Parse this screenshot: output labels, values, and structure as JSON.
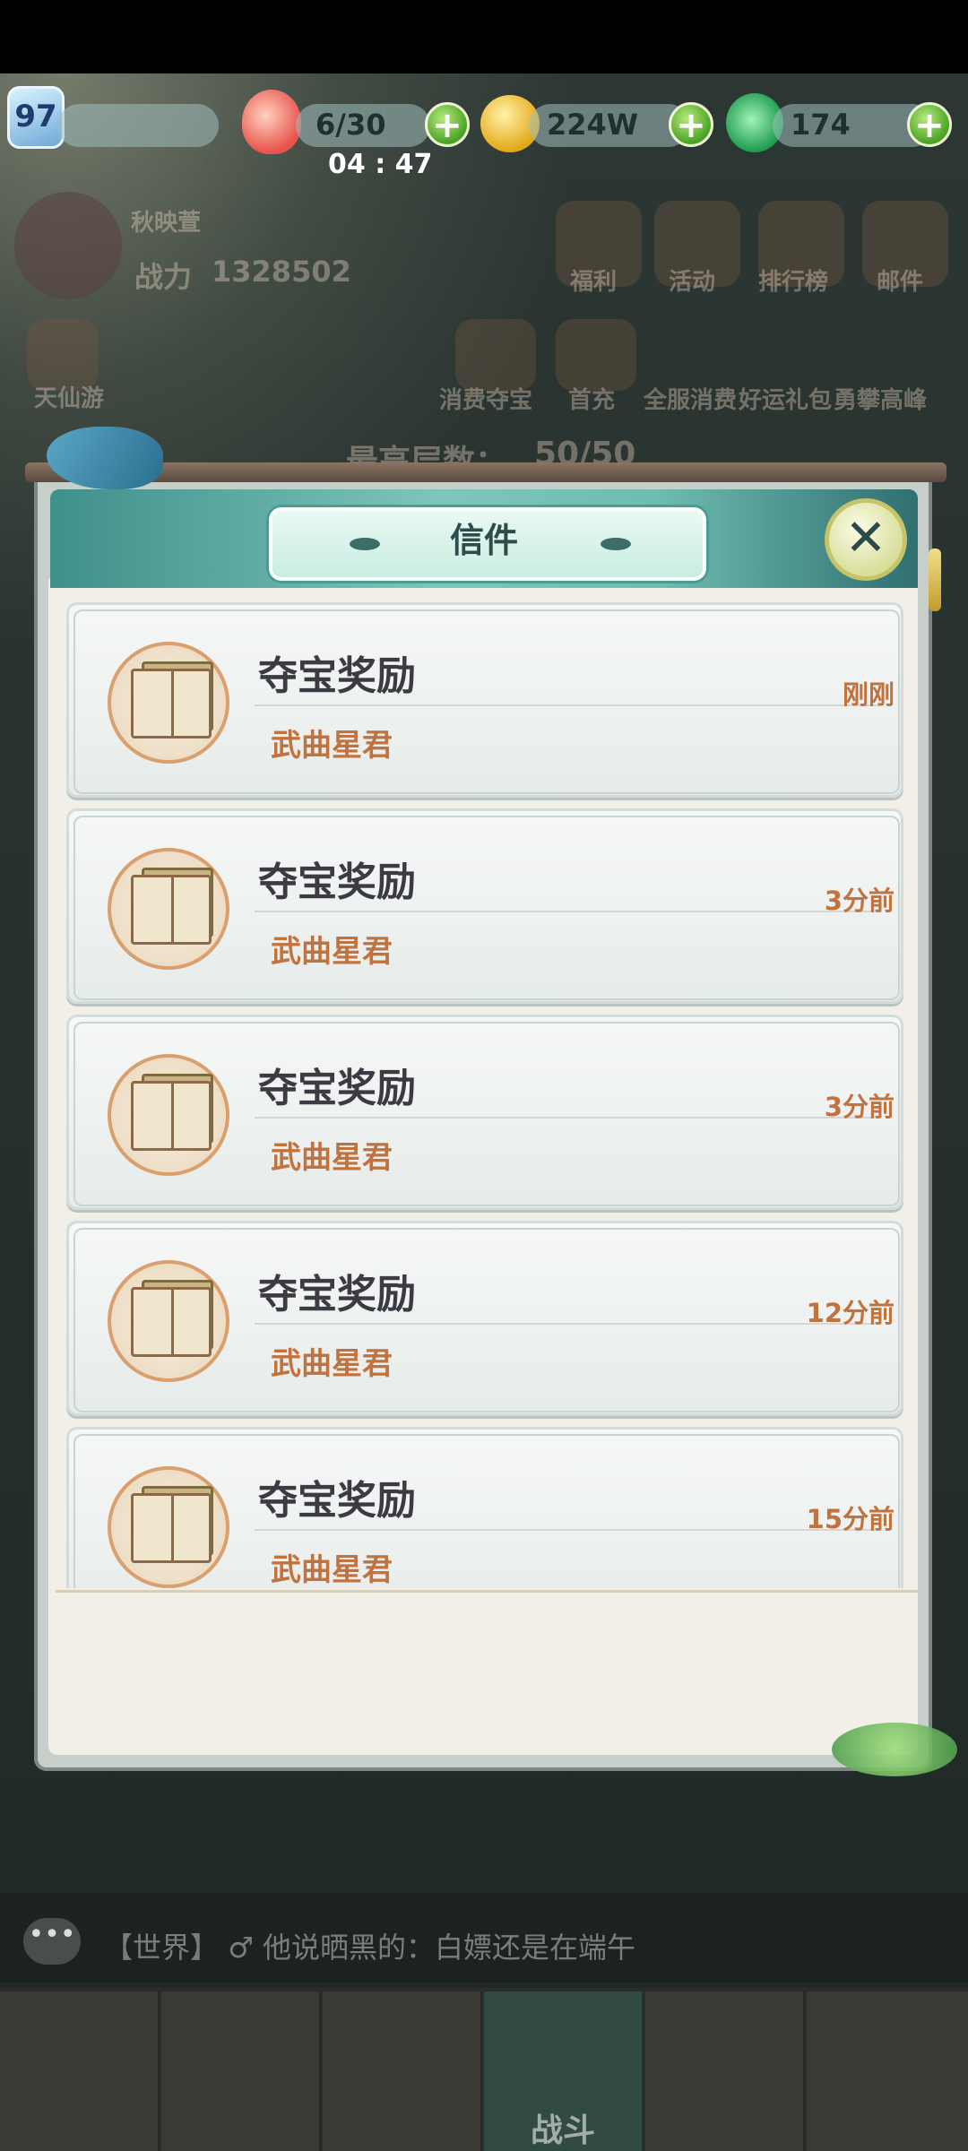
{
  "top_bar": {
    "level": "97",
    "stamina": "6/30",
    "timer": "04 : 47",
    "gold": "224W",
    "jade": "174"
  },
  "background": {
    "player_name": "秋映萱",
    "power_label": "战力",
    "power_value": "1328502",
    "menu": [
      "福利",
      "活动",
      "排行榜",
      "邮件"
    ],
    "row2": [
      "天仙游",
      "消费夺宝",
      "首充",
      "全服消费",
      "好运礼包",
      "勇攀高峰"
    ],
    "floor_label": "最高层数：",
    "floor_value": "50/50"
  },
  "mail_panel": {
    "title": "信件",
    "close_icon": "close-cross-icon",
    "mails": [
      {
        "subject": "夺宝奖励",
        "sender": "武曲星君",
        "time": "刚刚"
      },
      {
        "subject": "夺宝奖励",
        "sender": "武曲星君",
        "time": "3分前"
      },
      {
        "subject": "夺宝奖励",
        "sender": "武曲星君",
        "time": "3分前"
      },
      {
        "subject": "夺宝奖励",
        "sender": "武曲星君",
        "time": "12分前"
      },
      {
        "subject": "夺宝奖励",
        "sender": "武曲星君",
        "time": "15分前"
      }
    ]
  },
  "chat": {
    "channel": "【世界】",
    "message": "他说晒黑的：白嫖还是在端午"
  },
  "tabbar": {
    "active_label": "战斗"
  },
  "colors": {
    "accent_orange": "#c0733f",
    "header_teal": "#6fbcb1",
    "plus_green": "#4aa325"
  }
}
